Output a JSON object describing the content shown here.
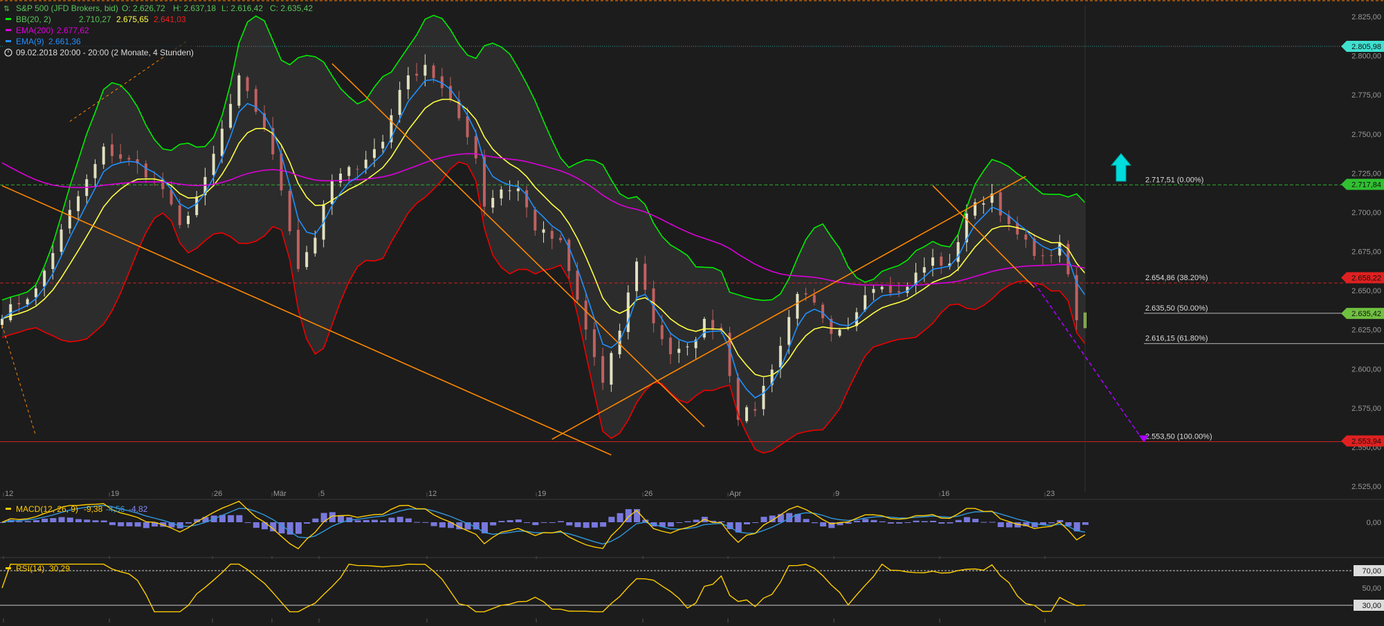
{
  "header": {
    "symbol_label": "S&P 500 (JFD Brokers, bid)",
    "ohlc": {
      "o": "O: 2.626,72",
      "h": "H: 2.637,18",
      "l": "L: 2.616,42",
      "c": "C: 2.635,42"
    },
    "bb": {
      "label": "BB(20, 2)",
      "mid": "2.710,27",
      "upper": "2.675,65",
      "lower": "2.641,03"
    },
    "ema200": {
      "label": "EMA(200)",
      "value": "2.677,62"
    },
    "ema9": {
      "label": "EMA(9)",
      "value": "2.661,36"
    },
    "timeframe": "09.02.2018 20:00 - 20:00   (2 Monate, 4 Stunden)"
  },
  "colors": {
    "background": "#1c1c1c",
    "candle_up": "#e0e0c0",
    "candle_down": "#c06060",
    "bb_upper": "#00ee00",
    "bb_lower": "#ee0000",
    "bb_mid": "#ffff44",
    "bb_fill": "#2c2c2c",
    "ema200": "#dd00dd",
    "ema9": "#2090ff",
    "trendline": "#ff8800",
    "fib_arrow": "#aa00ff",
    "up_arrow": "#00dddd",
    "macd_line": "#ffcc00",
    "signal_line": "#3399dd",
    "histogram": "#8888ff",
    "rsi_line": "#ffcc00"
  },
  "chart_data": [
    {
      "type": "candlestick",
      "title": "S&P 500 (JFD Brokers, bid)",
      "interval": "4 Stunden",
      "ylim": [
        2525,
        2840
      ],
      "y_ticks": [
        "2.825,00",
        "2.800,00",
        "2.775,00",
        "2.750,00",
        "2.725,00",
        "2.700,00",
        "2.675,00",
        "2.650,00",
        "2.625,00",
        "2.600,00",
        "2.575,00",
        "2.550,00",
        "2.525,00"
      ],
      "x_ticks": [
        "12",
        "19",
        "26",
        "Mär",
        "5",
        "12",
        "19",
        "26",
        "Apr",
        "9",
        "16",
        "23"
      ],
      "close_path": [
        [
          0,
          2635
        ],
        [
          4,
          2650
        ],
        [
          8,
          2700
        ],
        [
          12,
          2740
        ],
        [
          16,
          2730
        ],
        [
          19,
          2715
        ],
        [
          21,
          2690
        ],
        [
          24,
          2720
        ],
        [
          28,
          2785
        ],
        [
          31,
          2755
        ],
        [
          33,
          2715
        ],
        [
          35,
          2665
        ],
        [
          37,
          2685
        ],
        [
          39,
          2720
        ],
        [
          42,
          2730
        ],
        [
          45,
          2745
        ],
        [
          47,
          2780
        ],
        [
          50,
          2795
        ],
        [
          53,
          2770
        ],
        [
          55,
          2750
        ],
        [
          56,
          2735
        ],
        [
          57,
          2705
        ],
        [
          59,
          2715
        ],
        [
          61,
          2715
        ],
        [
          63,
          2690
        ],
        [
          66,
          2680
        ],
        [
          69,
          2625
        ],
        [
          71,
          2590
        ],
        [
          73,
          2625
        ],
        [
          75,
          2670
        ],
        [
          77,
          2630
        ],
        [
          79,
          2610
        ],
        [
          81,
          2612
        ],
        [
          83,
          2630
        ],
        [
          85,
          2625
        ],
        [
          87,
          2570
        ],
        [
          89,
          2575
        ],
        [
          92,
          2615
        ],
        [
          94,
          2650
        ],
        [
          96,
          2640
        ],
        [
          98,
          2620
        ],
        [
          100,
          2625
        ],
        [
          102,
          2650
        ],
        [
          104,
          2655
        ],
        [
          106,
          2648
        ],
        [
          108,
          2660
        ],
        [
          110,
          2670
        ],
        [
          112,
          2665
        ],
        [
          114,
          2700
        ],
        [
          117,
          2712
        ],
        [
          119,
          2690
        ],
        [
          121,
          2680
        ],
        [
          123,
          2670
        ],
        [
          125,
          2678
        ],
        [
          126,
          2660
        ],
        [
          127,
          2630
        ],
        [
          128,
          2635.4
        ]
      ],
      "last_close": 2635.42,
      "price_tags": [
        {
          "label": "2.805,98",
          "value": 2805.98,
          "color": "#40e0d0"
        },
        {
          "label": "2.717,84",
          "value": 2717.84,
          "color": "#30c030"
        },
        {
          "label": "2.658,22",
          "value": 2658.22,
          "color": "#e02020"
        },
        {
          "label": "2.635,42",
          "value": 2635.42,
          "color": "#70c040"
        },
        {
          "label": "2.553,94",
          "value": 2553.94,
          "color": "#e02020"
        }
      ],
      "fibonacci": [
        {
          "label": "2.717,51 (0.00%)",
          "value": 2717.51
        },
        {
          "label": "2.654,86 (38.20%)",
          "value": 2654.86
        },
        {
          "label": "2.635,50 (50.00%)",
          "value": 2635.5
        },
        {
          "label": "2.616,15 (61.80%)",
          "value": 2616.15
        },
        {
          "label": "2.553,50 (100.00%)",
          "value": 2553.5
        }
      ],
      "trendlines": [
        {
          "from": [
            0,
            2717
          ],
          "to": [
            72,
            2545
          ]
        },
        {
          "from": [
            39,
            2795
          ],
          "to": [
            83,
            2563
          ]
        },
        {
          "from": [
            65,
            2555
          ],
          "to": [
            121,
            2723
          ]
        },
        {
          "from": [
            110,
            2717
          ],
          "to": [
            122,
            2652
          ]
        },
        {
          "from": [
            8,
            2758
          ],
          "to": [
            22,
            2810
          ]
        },
        {
          "from": [
            0,
            2628
          ],
          "to": [
            4,
            2557
          ]
        }
      ],
      "projection": {
        "from": [
          122,
          2655
        ],
        "to": [
          125,
          2553.5
        ]
      },
      "signal_arrow": "up"
    },
    {
      "type": "line",
      "title": "MACD(12, 26, 9)",
      "legend": [
        "-9,38",
        "-4,56",
        "-4,82"
      ],
      "y_ticks": [
        "0,00"
      ],
      "series": [
        {
          "name": "MACD",
          "color": "#ffcc00"
        },
        {
          "name": "Signal",
          "color": "#3399dd"
        },
        {
          "name": "Histogram",
          "color": "#8888ff"
        }
      ]
    },
    {
      "type": "line",
      "title": "RSI(14)",
      "legend": [
        "30,29"
      ],
      "ylim": [
        0,
        100
      ],
      "y_ticks": [
        "70,00",
        "50,00",
        "30,00"
      ],
      "last_value": 30.29
    }
  ]
}
